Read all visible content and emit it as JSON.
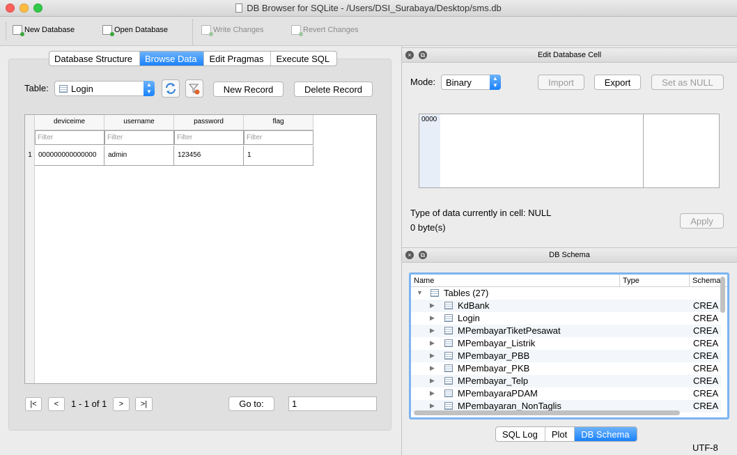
{
  "window": {
    "title": "DB Browser for SQLite - /Users/DSI_Surabaya/Desktop/sms.db"
  },
  "toolbar": {
    "new_database": "New Database",
    "open_database": "Open Database",
    "write_changes": "Write Changes",
    "revert_changes": "Revert Changes"
  },
  "tabs": [
    "Database Structure",
    "Browse Data",
    "Edit Pragmas",
    "Execute SQL"
  ],
  "browse": {
    "table_label": "Table:",
    "table_value": "Login",
    "new_record": "New Record",
    "delete_record": "Delete Record",
    "columns": [
      "deviceime",
      "username",
      "password",
      "flag"
    ],
    "filter_placeholder": "Filter",
    "rows": [
      {
        "num": "1",
        "cells": [
          "000000000000000",
          "admin",
          "123456",
          "1"
        ]
      }
    ],
    "nav": {
      "first": "|<",
      "prev": "<",
      "page_info": "1 - 1 of 1",
      "next": ">",
      "last": ">|"
    },
    "goto_label": "Go to:",
    "goto_value": "1"
  },
  "edit_cell": {
    "title": "Edit Database Cell",
    "mode_label": "Mode:",
    "mode_value": "Binary",
    "import": "Import",
    "export": "Export",
    "set_null": "Set as NULL",
    "hex_addr": "0000",
    "type_info": "Type of data currently in cell: NULL",
    "size_info": "0 byte(s)",
    "apply": "Apply"
  },
  "schema": {
    "title": "DB Schema",
    "headers": [
      "Name",
      "Type",
      "Schema"
    ],
    "group": "Tables (27)",
    "items": [
      {
        "name": "KdBank",
        "schema": "CREA"
      },
      {
        "name": "Login",
        "schema": "CREA"
      },
      {
        "name": "MPembayarTiketPesawat",
        "schema": "CREA"
      },
      {
        "name": "MPembayar_Listrik",
        "schema": "CREA"
      },
      {
        "name": "MPembayar_PBB",
        "schema": "CREA"
      },
      {
        "name": "MPembayar_PKB",
        "schema": "CREA"
      },
      {
        "name": "MPembayar_Telp",
        "schema": "CREA"
      },
      {
        "name": "MPembayaraPDAM",
        "schema": "CREA"
      },
      {
        "name": "MPembayaran_NonTaglis",
        "schema": "CREA"
      }
    ]
  },
  "bottom_tabs": [
    "SQL Log",
    "Plot",
    "DB Schema"
  ],
  "status": {
    "encoding": "UTF-8"
  }
}
